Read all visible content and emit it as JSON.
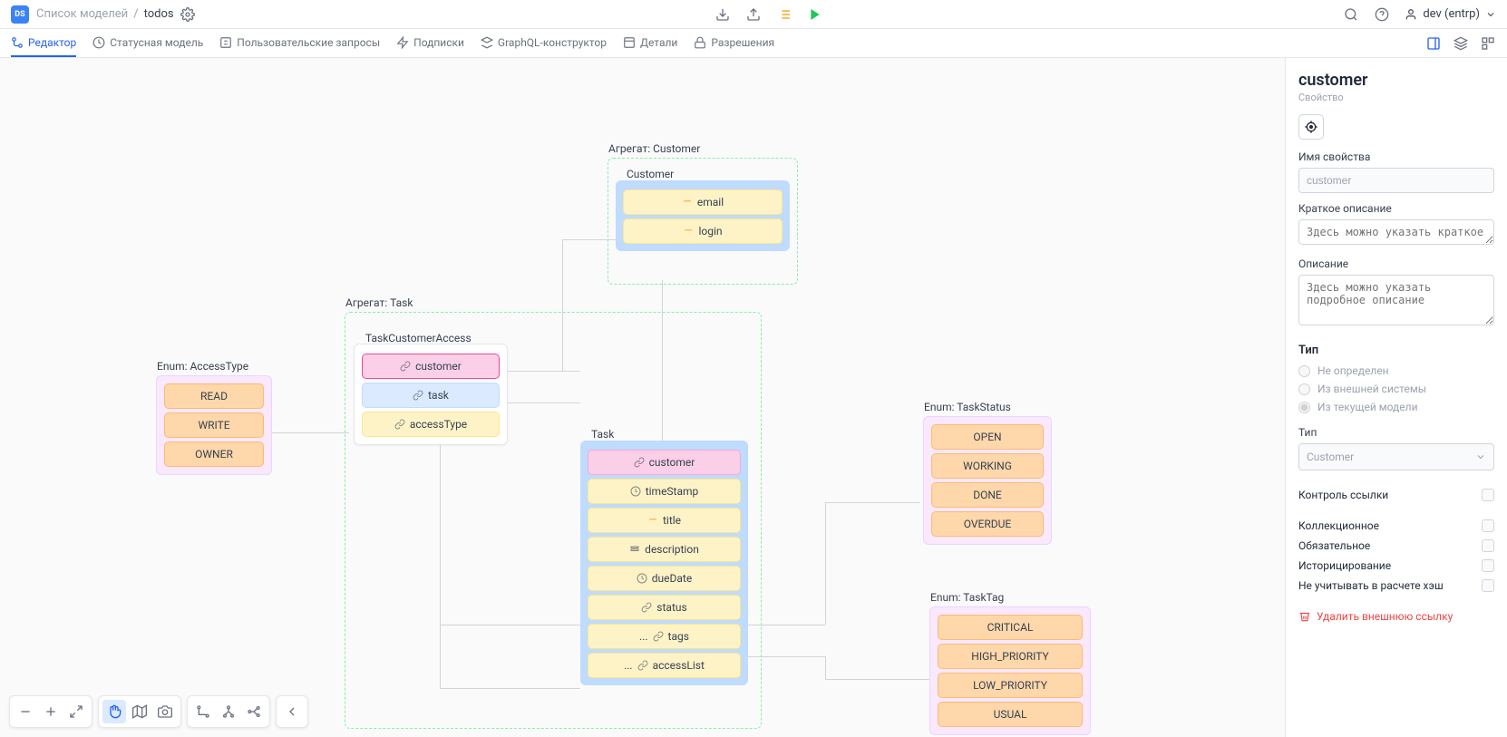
{
  "header": {
    "logo": "DS",
    "breadcrumb_root": "Список моделей",
    "breadcrumb_sep": "/",
    "breadcrumb_current": "todos",
    "user": "dev (entrp)"
  },
  "tabs": [
    {
      "label": "Редактор"
    },
    {
      "label": "Статусная модель"
    },
    {
      "label": "Пользовательские запросы"
    },
    {
      "label": "Подписки"
    },
    {
      "label": "GraphQL-конструктор"
    },
    {
      "label": "Детали"
    },
    {
      "label": "Разрешения"
    }
  ],
  "canvas": {
    "aggregates": {
      "customer": {
        "label": "Агрегат: Customer"
      },
      "task": {
        "label": "Агрегат: Task"
      }
    },
    "entities": {
      "customer": {
        "title": "Customer",
        "fields": [
          "email",
          "login"
        ]
      },
      "taskCustomerAccess": {
        "title": "TaskCustomerAccess",
        "fields": [
          "customer",
          "task",
          "accessType"
        ]
      },
      "task": {
        "title": "Task",
        "fields": [
          "customer",
          "timeStamp",
          "title",
          "description",
          "dueDate",
          "status",
          "tags",
          "accessList"
        ]
      }
    },
    "enums": {
      "accessType": {
        "label": "Enum: AccessType",
        "values": [
          "READ",
          "WRITE",
          "OWNER"
        ]
      },
      "taskStatus": {
        "label": "Enum: TaskStatus",
        "values": [
          "OPEN",
          "WORKING",
          "DONE",
          "OVERDUE"
        ]
      },
      "taskTag": {
        "label": "Enum: TaskTag",
        "values": [
          "CRITICAL",
          "HIGH_PRIORITY",
          "LOW_PRIORITY",
          "USUAL"
        ]
      }
    }
  },
  "sidebar": {
    "title": "customer",
    "subtitle": "Свойство",
    "name_label": "Имя свойства",
    "name_value": "customer",
    "short_desc_label": "Краткое описание",
    "short_desc_placeholder": "Здесь можно указать краткое",
    "desc_label": "Описание",
    "desc_placeholder": "Здесь можно указать подробное описание",
    "type_heading": "Тип",
    "radio": [
      "Не определен",
      "Из внешней системы",
      "Из текущей модели"
    ],
    "type2_label": "Тип",
    "type2_value": "Customer",
    "switches": [
      "Контроль ссылки",
      "Коллекционное",
      "Обязательное",
      "Историцирование",
      "Не учитывать в расчете хэш"
    ],
    "delete": "Удалить внешнюю ссылку"
  },
  "prefix": {
    "many": "..."
  }
}
